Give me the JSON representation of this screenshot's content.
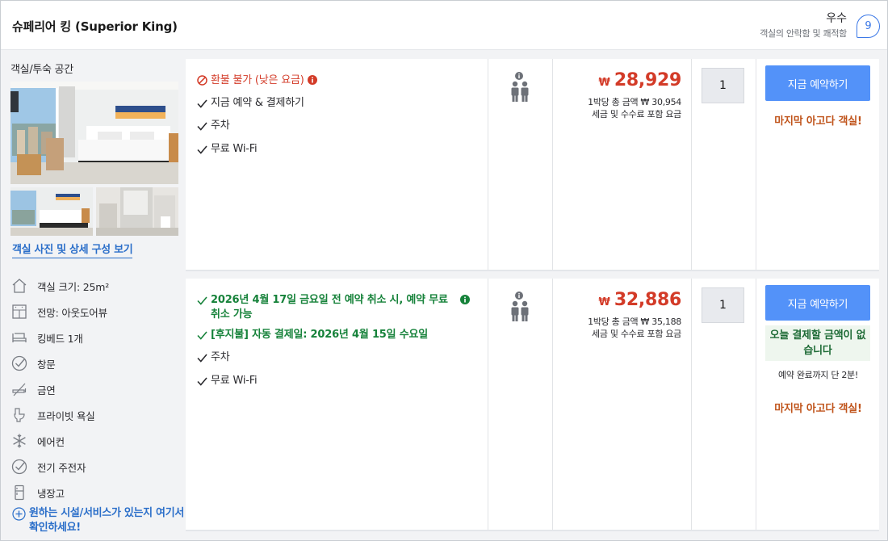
{
  "header": {
    "room_name": "슈페리어 킹 (Superior King)",
    "rating_word": "우수",
    "rating_caption": "객실의 안락함 및 쾌적함",
    "rating_score": "9"
  },
  "left_panel": {
    "space_label": "객실/투숙 공간",
    "photos_link": "객실 사진 및 상세 구성 보기",
    "amenities": [
      {
        "icon": "room-size-icon",
        "label": "객실 크기: 25m²"
      },
      {
        "icon": "window-view-icon",
        "label": "전망: 아웃도어뷰"
      },
      {
        "icon": "bed-icon",
        "label": "킹베드 1개"
      },
      {
        "icon": "check-circle-icon",
        "label": "창문"
      },
      {
        "icon": "no-smoking-icon",
        "label": "금연"
      },
      {
        "icon": "toilet-icon",
        "label": "프라이빗 욕실"
      },
      {
        "icon": "snowflake-icon",
        "label": "에어컨"
      },
      {
        "icon": "check-circle-icon",
        "label": "전기 주전자"
      },
      {
        "icon": "fridge-icon",
        "label": "냉장고"
      }
    ],
    "more_link": "원하는 시설/서비스가 있는지 여기서 확인하세요!"
  },
  "offers": [
    {
      "features": [
        {
          "style": "red",
          "icon": "no-refund-icon",
          "text": "환불 불가 (낮은 요금)",
          "info": true
        },
        {
          "style": "plain",
          "icon": "check-icon",
          "text": "지금 예약 & 결제하기"
        },
        {
          "style": "plain",
          "icon": "check-icon",
          "text": "주차"
        },
        {
          "style": "plain",
          "icon": "check-icon",
          "text": "무료 Wi-Fi"
        }
      ],
      "price_currency": "₩",
      "price": "28,929",
      "price_total_line": "1박당 총 금액 ₩ 30,954",
      "price_tax_line": "세금 및 수수료 포함 요금",
      "quantity": "1",
      "book_label": "지금 예약하기",
      "urgency": "마지막 아고다 객실!"
    },
    {
      "features": [
        {
          "style": "green",
          "icon": "check-icon",
          "text": "2026년 4월 17일 금요일 전 예약 취소 시, 예약 무료 취소 가능",
          "info": true
        },
        {
          "style": "green",
          "icon": "check-icon",
          "text": "[후지불] 자동 결제일: 2026년 4월 15일 수요일"
        },
        {
          "style": "plain",
          "icon": "check-icon",
          "text": "주차"
        },
        {
          "style": "plain",
          "icon": "check-icon",
          "text": "무료 Wi-Fi"
        }
      ],
      "price_currency": "₩",
      "price": "32,886",
      "price_total_line": "1박당 총 금액 ₩ 35,188",
      "price_tax_line": "세금 및 수수료 포함 요금",
      "quantity": "1",
      "book_label": "지금 예약하기",
      "pay_today": "오늘 결제할 금액이 없습니다",
      "countdown": "예약 완료까지 단 2분!",
      "urgency": "마지막 아고다 객실!"
    }
  ]
}
